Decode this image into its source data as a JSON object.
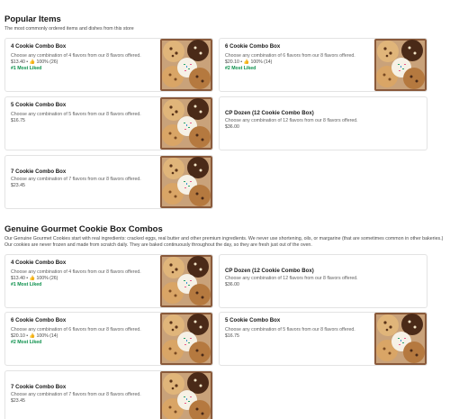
{
  "sections": [
    {
      "title": "Popular Items",
      "subtitle": "The most commonly ordered items and dishes from this store",
      "cards": [
        {
          "name": "4 Cookie Combo Box",
          "desc": "Choose any combination of 4 flavors from our 8 flavors offered.",
          "price": "$13.40 • 👍 100% (26)",
          "badge": "#1 Most Liked",
          "image": "cookie-box-photo"
        },
        {
          "name": "6 Cookie Combo Box",
          "desc": "Choose any combination of 6 flavors from our 8 flavors offered.",
          "price": "$20.10 • 👍 100% (14)",
          "badge": "#2 Most Liked",
          "image": "cookie-box-photo"
        },
        {
          "name": "5 Cookie Combo Box",
          "desc": "Choose any combination of 5 flavors from our 8 flavors offered.",
          "price": "$16.75",
          "badge": "",
          "image": "cookie-box-photo"
        },
        {
          "name": "CP Dozen (12 Cookie Combo Box)",
          "desc": "Choose any combination of 12 flavors from our 8 flavors offered.",
          "price": "$36.00",
          "badge": "",
          "image": ""
        },
        {
          "name": "7 Cookie Combo Box",
          "desc": "Choose any combination of 7 flavors from our 8 flavors offered.",
          "price": "$23.45",
          "badge": "",
          "image": "cookie-box-photo"
        }
      ]
    },
    {
      "title": "Genuine Gourmet Cookie Box Combos",
      "subtitle": "Our Genuine Gourmet Cookies start with real ingredients: cracked eggs, real butter and other premium ingredients. We never use shortening, oils, or margarine (that are sometimes common in other bakeries.) Our cookies are never frozen and made from scratch daily. They are baked continuously throughout the day, so they are fresh just out of the oven.",
      "cards": [
        {
          "name": "4 Cookie Combo Box",
          "desc": "Choose any combination of 4 flavors from our 8 flavors offered.",
          "price": "$13.40 • 👍 100% (26)",
          "badge": "#1 Most Liked",
          "image": "cookie-box-photo"
        },
        {
          "name": "CP Dozen (12 Cookie Combo Box)",
          "desc": "Choose any combination of 12 flavors from our 8 flavors offered.",
          "price": "$36.00",
          "badge": "",
          "image": ""
        },
        {
          "name": "6 Cookie Combo Box",
          "desc": "Choose any combination of 6 flavors from our 8 flavors offered.",
          "price": "$20.10 • 👍 100% (14)",
          "badge": "#2 Most Liked",
          "image": "cookie-box-photo"
        },
        {
          "name": "5 Cookie Combo Box",
          "desc": "Choose any combination of 5 flavors from our 8 flavors offered.",
          "price": "$16.75",
          "badge": "",
          "image": "cookie-box-photo"
        },
        {
          "name": "7 Cookie Combo Box",
          "desc": "Choose any combination of 7 flavors from our 8 flavors offered.",
          "price": "$23.45",
          "badge": "",
          "image": "cookie-box-photo"
        }
      ]
    }
  ],
  "colors": {
    "badge": "#0a8f4a",
    "border": "#e3e3e3",
    "text": "#191919"
  }
}
